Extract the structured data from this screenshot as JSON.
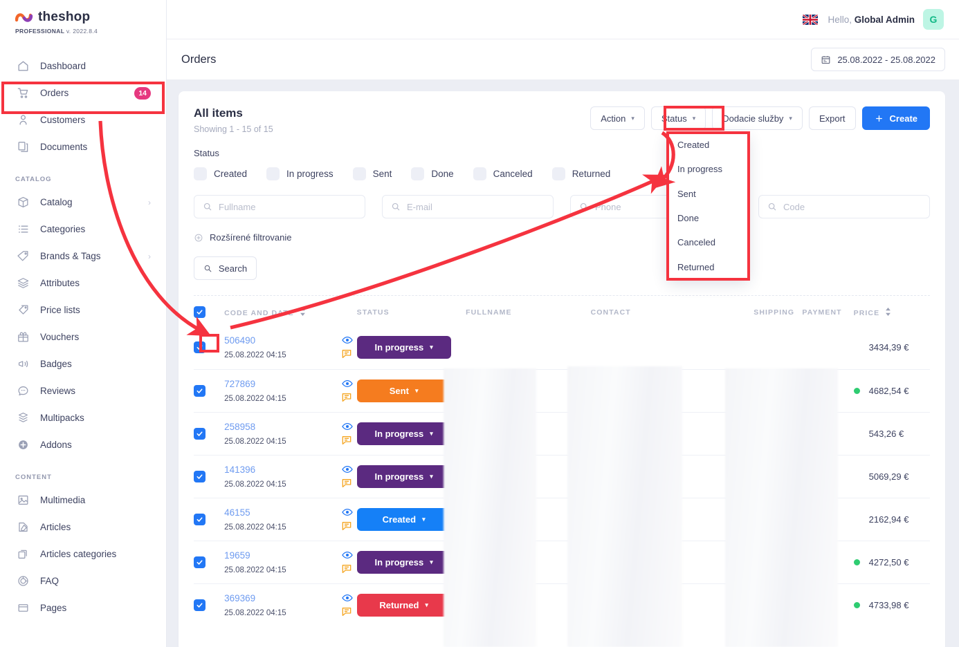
{
  "brand": {
    "name": "theshop",
    "edition": "PROFESSIONAL",
    "version": "v. 2022.8.4"
  },
  "topbar": {
    "flag_icon": "uk-flag-icon",
    "greeting_prefix": "Hello, ",
    "user_name": "Global Admin",
    "avatar_initial": "G"
  },
  "page": {
    "title": "Orders",
    "date_range": "25.08.2022 - 25.08.2022",
    "calendar_icon": "calendar-icon"
  },
  "sidebar": {
    "items": [
      {
        "label": "Dashboard",
        "icon": "home-icon",
        "badge": "",
        "chevron": false
      },
      {
        "label": "Orders",
        "icon": "cart-icon",
        "badge": "14",
        "chevron": false,
        "active": true
      },
      {
        "label": "Customers",
        "icon": "user-icon",
        "badge": "",
        "chevron": false
      },
      {
        "label": "Documents",
        "icon": "documents-icon",
        "badge": "",
        "chevron": false
      }
    ],
    "sections": [
      {
        "title": "CATALOG",
        "items": [
          {
            "label": "Catalog",
            "icon": "box-icon",
            "chevron": true
          },
          {
            "label": "Categories",
            "icon": "list-icon",
            "chevron": false
          },
          {
            "label": "Brands & Tags",
            "icon": "tag-icon",
            "chevron": true
          },
          {
            "label": "Attributes",
            "icon": "layers-icon",
            "chevron": true
          },
          {
            "label": "Price lists",
            "icon": "pricetag-icon",
            "chevron": false
          },
          {
            "label": "Vouchers",
            "icon": "gift-icon",
            "chevron": false
          },
          {
            "label": "Badges",
            "icon": "megaphone-icon",
            "chevron": false
          },
          {
            "label": "Reviews",
            "icon": "chat-icon",
            "chevron": false
          },
          {
            "label": "Multipacks",
            "icon": "multipack-icon",
            "chevron": false
          },
          {
            "label": "Addons",
            "icon": "plus-circle-icon",
            "chevron": false
          }
        ]
      },
      {
        "title": "CONTENT",
        "items": [
          {
            "label": "Multimedia",
            "icon": "image-icon",
            "chevron": false
          },
          {
            "label": "Articles",
            "icon": "pencil-icon",
            "chevron": false
          },
          {
            "label": "Articles categories",
            "icon": "copy-icon",
            "chevron": false
          },
          {
            "label": "FAQ",
            "icon": "faq-icon",
            "chevron": false
          },
          {
            "label": "Pages",
            "icon": "page-icon",
            "chevron": false
          }
        ]
      }
    ]
  },
  "list": {
    "heading": "All items",
    "showing": "Showing 1 - 15 of 15",
    "toolbar": {
      "action_label": "Action",
      "status_label": "Status",
      "delivery_label": "Dodacie služby",
      "export_label": "Export",
      "create_label": "Create",
      "create_icon": "plus-icon"
    },
    "status_filter_label": "Status",
    "status_filters": [
      "Created",
      "In progress",
      "Sent",
      "Done",
      "Canceled",
      "Returned"
    ],
    "search_fields": [
      {
        "placeholder": "Fullname",
        "value": "",
        "icon": "search-icon"
      },
      {
        "placeholder": "E-mail",
        "value": "",
        "icon": "search-icon"
      },
      {
        "placeholder": "Phone",
        "value": "",
        "icon": "search-icon"
      },
      {
        "placeholder": "Code",
        "value": "",
        "icon": "search-icon"
      }
    ],
    "advanced_filter_label": "Rozšírené filtrovanie",
    "advanced_filter_icon": "plus-circle-icon",
    "search_button_label": "Search",
    "search_button_icon": "search-icon"
  },
  "status_dropdown": {
    "open": true,
    "options": [
      "Created",
      "In progress",
      "Sent",
      "Done",
      "Canceled",
      "Returned"
    ]
  },
  "table": {
    "headers": [
      {
        "label": "",
        "sortable": false
      },
      {
        "label": "CODE AND DATE",
        "sortable": true
      },
      {
        "label": "",
        "sortable": false
      },
      {
        "label": "STATUS",
        "sortable": false
      },
      {
        "label": "FULLNAME",
        "sortable": false
      },
      {
        "label": "CONTACT",
        "sortable": false
      },
      {
        "label": "SHIPPING",
        "sortable": false
      },
      {
        "label": "PAYMENT",
        "sortable": false
      },
      {
        "label": "PRICE",
        "sortable": true
      }
    ],
    "header_checkbox_checked": true,
    "rows": [
      {
        "checked": true,
        "code": "506490",
        "date": "25.08.2022 04:15",
        "status": "In progress",
        "status_color": "#5b2a80",
        "price": "3434,39 €",
        "paid": false
      },
      {
        "checked": true,
        "code": "727869",
        "date": "25.08.2022 04:15",
        "status": "Sent",
        "status_color": "#f57c1f",
        "price": "4682,54 €",
        "paid": true
      },
      {
        "checked": true,
        "code": "258958",
        "date": "25.08.2022 04:15",
        "status": "In progress",
        "status_color": "#5b2a80",
        "price": "543,26 €",
        "paid": false
      },
      {
        "checked": true,
        "code": "141396",
        "date": "25.08.2022 04:15",
        "status": "In progress",
        "status_color": "#5b2a80",
        "price": "5069,29 €",
        "paid": false
      },
      {
        "checked": true,
        "code": "46155",
        "date": "25.08.2022 04:15",
        "status": "Created",
        "status_color": "#1580f7",
        "price": "2162,94 €",
        "paid": false
      },
      {
        "checked": true,
        "code": "19659",
        "date": "25.08.2022 04:15",
        "status": "In progress",
        "status_color": "#5b2a80",
        "price": "4272,50 €",
        "paid": true
      },
      {
        "checked": true,
        "code": "369369",
        "date": "25.08.2022 04:15",
        "status": "Returned",
        "status_color": "#e8394b",
        "price": "4733,98 €",
        "paid": true
      }
    ],
    "row_icons": [
      "eye-icon",
      "note-icon"
    ]
  },
  "annotations": {
    "highlight_color": "#f5333f",
    "boxes": [
      "orders-nav-item",
      "status-toolbar-button",
      "status-dropdown-menu",
      "select-all-checkbox"
    ],
    "arrows": [
      "orders-to-select-all",
      "select-all-to-status-button",
      "status-button-to-dropdown"
    ]
  },
  "colors": {
    "accent": "#2277f5",
    "badge": "#e6387f",
    "paid_dot": "#2ecc71",
    "annotation": "#f5333f"
  }
}
